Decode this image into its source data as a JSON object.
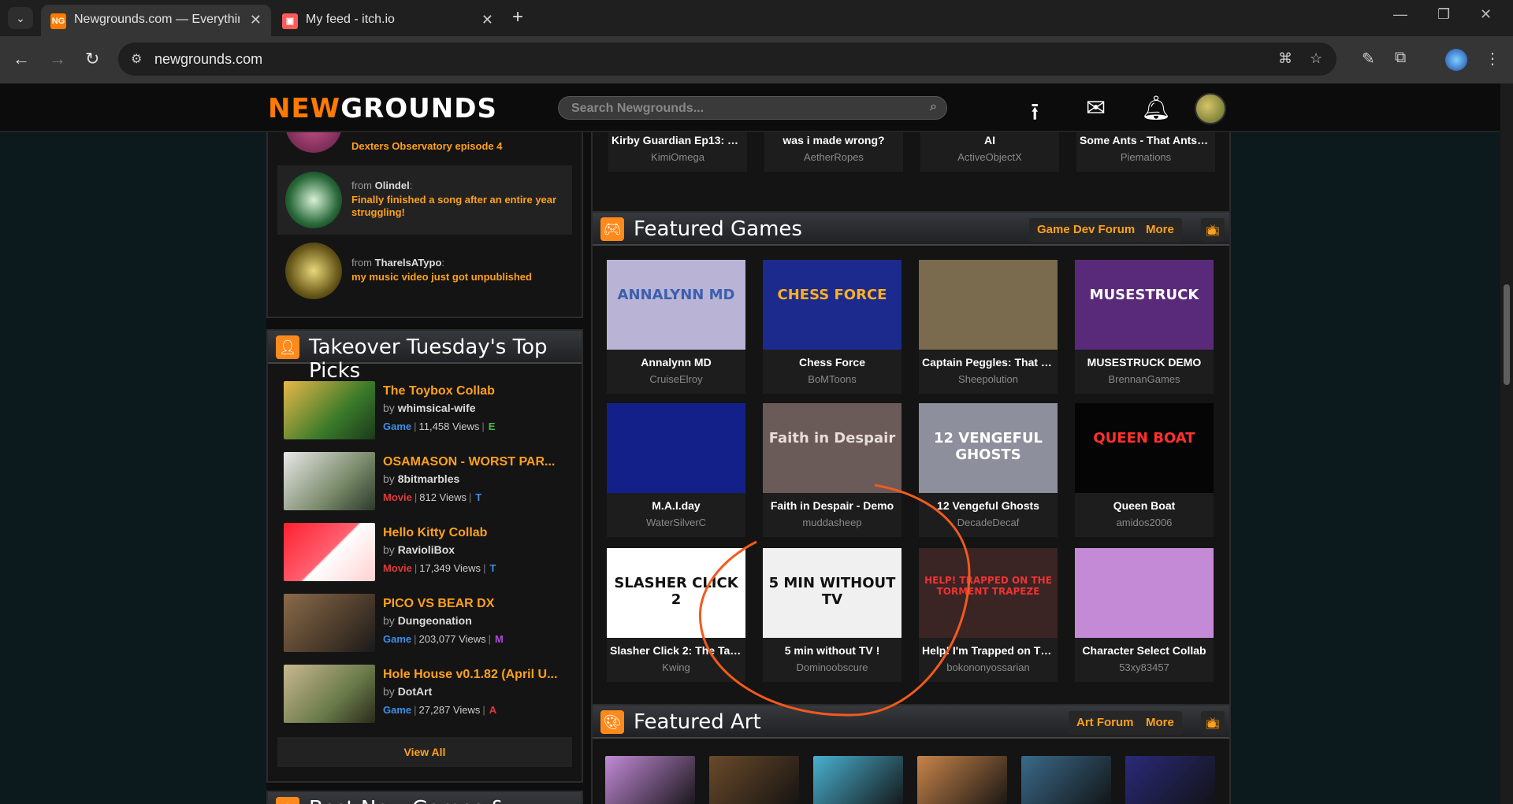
{
  "browser": {
    "tabs": [
      {
        "title": "Newgrounds.com — Everything",
        "favicon": "NG"
      },
      {
        "title": "My feed - itch.io",
        "favicon": "itch-icon"
      }
    ],
    "url": "newgrounds.com"
  },
  "header": {
    "logo_new": "NEW",
    "logo_grounds": "GROUNDS",
    "search_placeholder": "Search Newgrounds..."
  },
  "feed": [
    {
      "from_label": "",
      "user": "",
      "message": "Dexters Observatory episode 4"
    },
    {
      "from_label": "from",
      "user": "Olindel",
      "message": "Finally finished a song after an entire year struggling!"
    },
    {
      "from_label": "from",
      "user": "TharelsATypo",
      "message": "my music video just got unpublished"
    }
  ],
  "picks": {
    "title": "Takeover Tuesday's Top Picks",
    "items": [
      {
        "title": "The Toybox Collab",
        "by": "by",
        "author": "whimsical-wife",
        "type": "Game",
        "views": "11,458 Views",
        "rating": "E",
        "type_color": "#3b8fe6",
        "rating_color": "#42c04a"
      },
      {
        "title": "OSAMASON - WORST PAR...",
        "by": "by",
        "author": "8bitmarbles",
        "type": "Movie",
        "views": "812 Views",
        "rating": "T",
        "type_color": "#e23a3a",
        "rating_color": "#3b8fe6"
      },
      {
        "title": "Hello Kitty Collab",
        "by": "by",
        "author": "RavioliBox",
        "type": "Movie",
        "views": "17,349 Views",
        "rating": "T",
        "type_color": "#e23a3a",
        "rating_color": "#3b8fe6"
      },
      {
        "title": "PICO VS BEAR DX",
        "by": "by",
        "author": "Dungeonation",
        "type": "Game",
        "views": "203,077 Views",
        "rating": "M",
        "type_color": "#3b8fe6",
        "rating_color": "#b04ae0"
      },
      {
        "title": "Hole House v0.1.82 (April U...",
        "by": "by",
        "author": "DotArt",
        "type": "Game",
        "views": "27,287 Views",
        "rating": "A",
        "type_color": "#3b8fe6",
        "rating_color": "#e23a3a"
      }
    ],
    "view_all": "View All",
    "next_panel_title": "Best New Games & Movies!"
  },
  "top_row": [
    {
      "title": "Kirby Guardian Ep13: O...",
      "author": "KimiOmega"
    },
    {
      "title": "was i made wrong?",
      "author": "AetherRopes"
    },
    {
      "title": "AI",
      "author": "ActiveObjectX"
    },
    {
      "title": "Some Ants - That Antsy ...",
      "author": "Piemations"
    }
  ],
  "featured_games": {
    "title": "Featured Games",
    "forum_button": "Game Dev Forum",
    "more_button": "More",
    "items": [
      {
        "title": "Annalynn MD",
        "author": "CruiseElroy",
        "thumb_text": "ANNALYNN MD",
        "bg": "#b9b4d6",
        "fg": "#3c5fae"
      },
      {
        "title": "Chess Force",
        "author": "BoMToons",
        "thumb_text": "CHESS FORCE",
        "bg": "#1b2a8c",
        "fg": "#ffb020"
      },
      {
        "title": "Captain Peggles: That M...",
        "author": "Sheepolution",
        "thumb_text": "",
        "bg": "#7a6a4e",
        "fg": "#fff"
      },
      {
        "title": "MUSESTRUCK DEMO",
        "author": "BrennanGames",
        "thumb_text": "MUSESTRUCK",
        "bg": "#5a2a7a",
        "fg": "#ffffff"
      },
      {
        "title": "M.A.I.day",
        "author": "WaterSilverC",
        "thumb_text": "",
        "bg": "#14208a",
        "fg": "#c33"
      },
      {
        "title": "Faith in Despair - Demo",
        "author": "muddasheep",
        "thumb_text": "Faith in Despair",
        "bg": "#6a5a58",
        "fg": "#e8ddd8"
      },
      {
        "title": "12 Vengeful Ghosts",
        "author": "DecadeDecaf",
        "thumb_text": "12 VENGEFUL GHOSTS",
        "bg": "#8e8f9c",
        "fg": "#ffffff"
      },
      {
        "title": "Queen Boat",
        "author": "amidos2006",
        "thumb_text": "QUEEN BOAT",
        "bg": "#050505",
        "fg": "#ff3030"
      },
      {
        "title": "Slasher Click 2: The Tale...",
        "author": "Kwing",
        "thumb_text": "SLASHER CLICK 2",
        "bg": "#ffffff",
        "fg": "#111"
      },
      {
        "title": "5 min without TV !",
        "author": "Dominoobscure",
        "thumb_text": "5 MIN WITHOUT TV",
        "bg": "#f0f0f0",
        "fg": "#111"
      },
      {
        "title": "Help! I'm Trapped on Th...",
        "author": "bokononyossarian",
        "thumb_text": "HELP! TRAPPED ON THE TORMENT TRAPEZE",
        "bg": "#3a2424",
        "fg": "#e33"
      },
      {
        "title": "Character Select Collab",
        "author": "53xy83457",
        "thumb_text": "",
        "bg": "#c48ad6",
        "fg": "#111"
      }
    ]
  },
  "featured_art": {
    "title": "Featured Art",
    "forum_button": "Art Forum",
    "more_button": "More",
    "thumbs": [
      "#c28ad6",
      "#6a4a2a",
      "#4ab0d0",
      "#c8844a",
      "#3a6a8a",
      "#2a2a7a"
    ]
  },
  "colors": {
    "accent": "#ffa11c",
    "annotation": "#f25a1c"
  }
}
